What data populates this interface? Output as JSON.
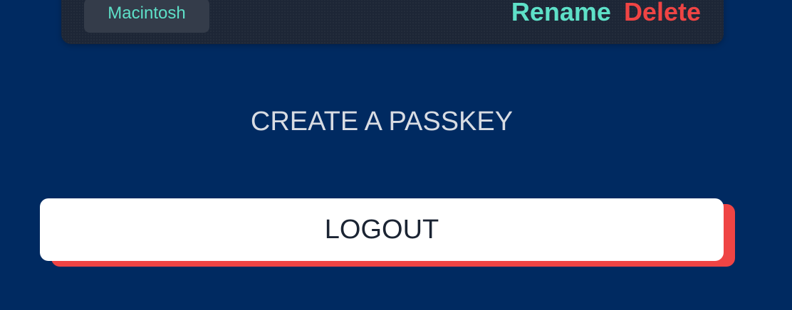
{
  "passkey_item": {
    "device_name": "Macintosh",
    "rename_label": "Rename",
    "delete_label": "Delete"
  },
  "create_passkey_label": "CREATE A PASSKEY",
  "logout_label": "LOGOUT",
  "colors": {
    "background": "#002a61",
    "card": "#1d2636",
    "accent_teal": "#5ee0c8",
    "danger_red": "#ef4444",
    "button_white": "#ffffff"
  }
}
